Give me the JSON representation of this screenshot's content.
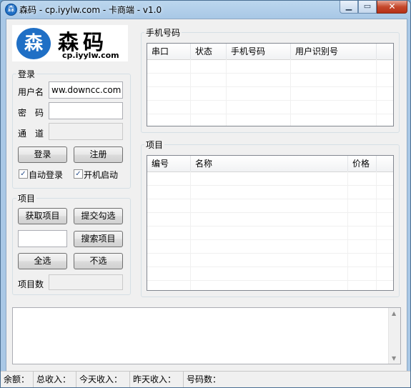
{
  "window": {
    "title": "森码 - cp.iyylw.com - 卡商端 - v1.0",
    "app_icon_char": "森",
    "min_glyph": "▁",
    "max_glyph": "▭",
    "close_glyph": "✕"
  },
  "logo": {
    "icon_char": "森",
    "name": "森码",
    "url": "cp.iyylw.com"
  },
  "login": {
    "group_label": "登录",
    "username_label": "用户名",
    "username_value": "ww.downcc.com",
    "password_label": "密　码",
    "channel_label": "通　道",
    "login_button": "登录",
    "register_button": "注册",
    "auto_login_label": "自动登录",
    "auto_login_checked": true,
    "startup_label": "开机启动",
    "startup_checked": true
  },
  "project": {
    "group_label": "项目",
    "get_button": "获取项目",
    "submit_button": "提交勾选",
    "search_button": "搜索项目",
    "select_all_button": "全选",
    "deselect_button": "不选",
    "count_label": "项目数"
  },
  "phones": {
    "group_label": "手机号码",
    "columns": [
      "串口",
      "状态",
      "手机号码",
      "用户识别号"
    ]
  },
  "items": {
    "group_label": "项目",
    "columns": [
      "编号",
      "名称",
      "价格"
    ]
  },
  "statusbar": {
    "balance": "余额：",
    "total_income": "总收入：",
    "today_income": "今天收入：",
    "yesterday_income": "昨天收入：",
    "number_count": "号码数："
  },
  "icons": {
    "check": "✓",
    "scroll_up": "▲",
    "scroll_down": "▼"
  },
  "colors": {
    "logo_blue": "#1f6fc5",
    "close_red": "#c5482c"
  }
}
